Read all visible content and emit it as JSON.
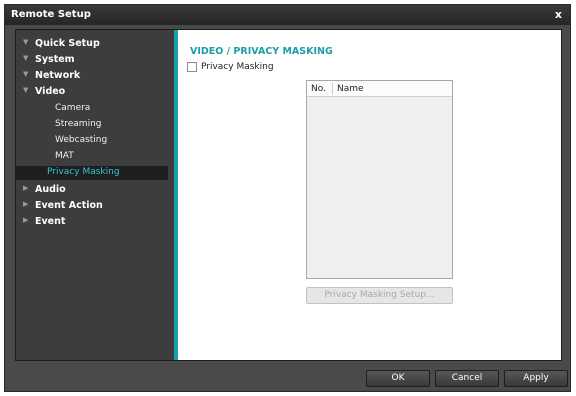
{
  "window": {
    "title": "Remote Setup",
    "close_glyph": "x"
  },
  "sidebar": {
    "items": [
      {
        "label": "Quick Setup",
        "level": 1,
        "arrow": "▼"
      },
      {
        "label": "System",
        "level": 1,
        "arrow": "▼"
      },
      {
        "label": "Network",
        "level": 1,
        "arrow": "▼"
      },
      {
        "label": "Video",
        "level": 1,
        "arrow": "▼"
      },
      {
        "label": "Camera",
        "level": 2
      },
      {
        "label": "Streaming",
        "level": 2
      },
      {
        "label": "Webcasting",
        "level": 2
      },
      {
        "label": "MAT",
        "level": 2
      },
      {
        "label": "Privacy Masking",
        "level": 2,
        "selected": true
      },
      {
        "label": "Audio",
        "level": 1,
        "arrow": "▶"
      },
      {
        "label": "Event Action",
        "level": 1,
        "arrow": "▶"
      },
      {
        "label": "Event",
        "level": 1,
        "arrow": "▶"
      }
    ]
  },
  "content": {
    "section_title": "VIDEO / PRIVACY MASKING",
    "checkbox_label": "Privacy Masking",
    "checkbox_checked": false,
    "list": {
      "col_no": "No.",
      "col_name": "Name",
      "rows": []
    },
    "setup_button": "Privacy Masking Setup..."
  },
  "footer": {
    "ok": "OK",
    "cancel": "Cancel",
    "apply": "Apply"
  },
  "colors": {
    "accent": "#1a9ea8",
    "selected_text": "#33c7d3"
  }
}
